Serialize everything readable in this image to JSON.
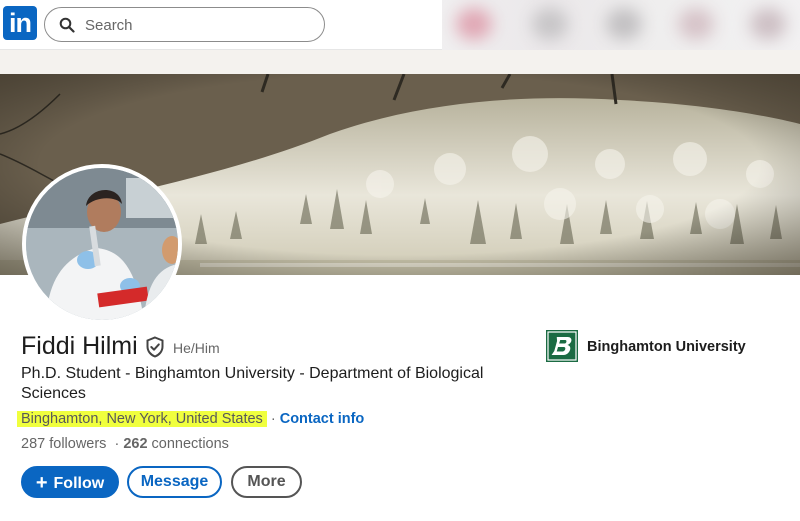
{
  "app": {
    "logo_text": "in"
  },
  "search": {
    "placeholder": "Search",
    "value": ""
  },
  "profile": {
    "name": "Fiddi Hilmi",
    "pronouns": "He/Him",
    "headline": "Ph.D. Student - Binghamton University - Department of Biological Sciences",
    "location": "Binghamton, New York, United States",
    "separator": "·",
    "contact_label": "Contact info",
    "followers": "287 followers",
    "network_separator": "·",
    "connections_count": "262",
    "connections_label": "connections"
  },
  "actions": {
    "follow_icon": "+",
    "follow_label": "Follow",
    "message_label": "Message",
    "more_label": "More"
  },
  "education": {
    "name": "Binghamton University"
  },
  "colors": {
    "brand": "#0a66c2",
    "highlight": "#f0ff3e",
    "university": "#1b6b43"
  },
  "icons": {
    "search": "search-icon",
    "verified": "verified-shield-icon",
    "university_logo": "binghamton-logo-icon"
  }
}
